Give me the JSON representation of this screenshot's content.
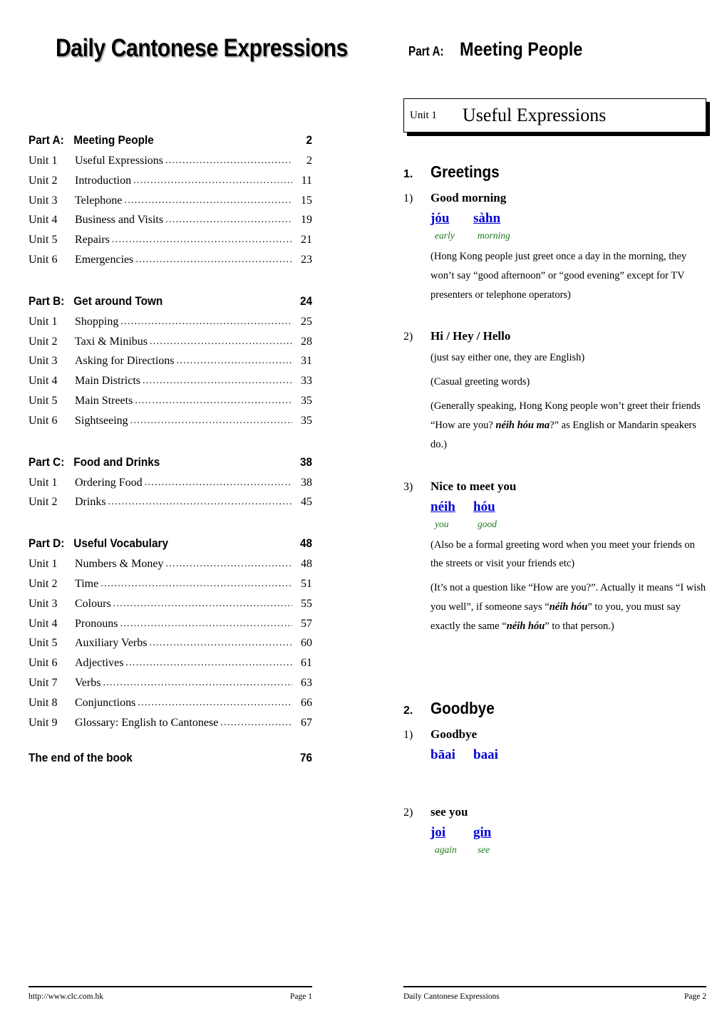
{
  "document": {
    "title": "Daily Cantonese Expressions"
  },
  "right_header": {
    "part_label": "Part A:",
    "part_title": "Meeting People"
  },
  "toc": {
    "parts": [
      {
        "label": "Part A:",
        "title": "Meeting People",
        "page": "2",
        "units": [
          {
            "label": "Unit 1",
            "title": "Useful Expressions",
            "page": "2"
          },
          {
            "label": "Unit 2",
            "title": "Introduction",
            "page": "11"
          },
          {
            "label": "Unit 3",
            "title": "Telephone",
            "page": "15"
          },
          {
            "label": "Unit 4",
            "title": "Business and Visits",
            "page": "19"
          },
          {
            "label": "Unit 5",
            "title": "Repairs",
            "page": "21"
          },
          {
            "label": "Unit 6",
            "title": "Emergencies",
            "page": "23"
          }
        ]
      },
      {
        "label": "Part B:",
        "title": "Get around Town",
        "page": "24",
        "units": [
          {
            "label": "Unit 1",
            "title": "Shopping",
            "page": "25"
          },
          {
            "label": "Unit 2",
            "title": "Taxi & Minibus",
            "page": "28"
          },
          {
            "label": "Unit 3",
            "title": "Asking for Directions",
            "page": "31"
          },
          {
            "label": "Unit 4",
            "title": "Main Districts",
            "page": "33"
          },
          {
            "label": "Unit 5",
            "title": "Main Streets",
            "page": "35"
          },
          {
            "label": "Unit 6",
            "title": "Sightseeing",
            "page": "35"
          }
        ]
      },
      {
        "label": "Part C:",
        "title": "Food and Drinks",
        "page": "38",
        "units": [
          {
            "label": "Unit 1",
            "title": "Ordering Food",
            "page": "38"
          },
          {
            "label": "Unit 2",
            "title": "Drinks",
            "page": "45"
          }
        ]
      },
      {
        "label": "Part D:",
        "title": "Useful Vocabulary",
        "page": "48",
        "units": [
          {
            "label": "Unit 1",
            "title": "Numbers & Money",
            "page": "48"
          },
          {
            "label": "Unit 2",
            "title": "Time",
            "page": "51"
          },
          {
            "label": "Unit 3",
            "title": "Colours",
            "page": "55"
          },
          {
            "label": "Unit 4",
            "title": "Pronouns",
            "page": "57"
          },
          {
            "label": "Unit 5",
            "title": "Auxiliary Verbs",
            "page": "60"
          },
          {
            "label": "Unit 6",
            "title": "Adjectives",
            "page": "61"
          },
          {
            "label": "Unit 7",
            "title": "Verbs",
            "page": "63"
          },
          {
            "label": "Unit 8",
            "title": "Conjunctions",
            "page": "66"
          },
          {
            "label": "Unit 9",
            "title": "Glossary: English to Cantonese",
            "page": "67"
          }
        ]
      }
    ],
    "end": {
      "title": "The end of the book",
      "page": "76"
    }
  },
  "lesson": {
    "unit_box": {
      "unit": "Unit 1",
      "title": "Useful Expressions"
    },
    "sections": [
      {
        "number": "1.",
        "title": "Greetings",
        "items": [
          {
            "number": "1)",
            "head": "Good morning",
            "romanization": [
              "jóu",
              "sàhn"
            ],
            "glosses": [
              "early",
              "morning"
            ],
            "notes": [
              "(Hong Kong people just greet once a day in the morning, they won’t say “good afternoon” or “good evening” except for TV presenters or telephone operators)"
            ]
          },
          {
            "number": "2)",
            "head": "Hi / Hey / Hello",
            "romanization": [],
            "glosses": [],
            "notes": [
              "(just say either one, they are English)",
              "(Casual greeting words)",
              "(Generally speaking, Hong Kong people won’t greet their friends “How are you? néih hóu ma?” as English or Mandarin speakers do.)"
            ]
          },
          {
            "number": "3)",
            "head": "Nice to meet you",
            "romanization": [
              "néih",
              "hóu"
            ],
            "glosses": [
              "you",
              "good"
            ],
            "notes": [
              "(Also be a formal greeting word when you meet your friends on the streets or visit your friends etc)",
              "(It’s not a question like “How are you?”. Actually it means “I wish you well”, if someone says “néih hóu” to you, you must say exactly the same “néih hóu” to that person.)"
            ]
          }
        ]
      },
      {
        "number": "2.",
        "title": "Goodbye",
        "items": [
          {
            "number": "1)",
            "head": "Goodbye",
            "romanization": [
              "bāai",
              "baai"
            ],
            "glosses": [],
            "notes": []
          },
          {
            "number": "2)",
            "head": "see you",
            "romanization": [
              "joi",
              "gin"
            ],
            "glosses": [
              "again",
              "see"
            ],
            "notes": []
          }
        ]
      }
    ],
    "note_fragments": {
      "note_2c_pre": "(Generally speaking, Hong Kong people won’t greet their friends “How are you? ",
      "note_2c_bi": "néih hóu ma",
      "note_2c_post": "?” as English or Mandarin speakers do.)",
      "note_3b_pre": "(It’s not a question like “How are you?”. Actually it means “I wish you well”, if someone says “",
      "note_3b_bi1": "néih hóu",
      "note_3b_mid": "” to you, you must say exactly the same “",
      "note_3b_bi2": "néih hóu",
      "note_3b_post": "” to that person.)"
    }
  },
  "footers": {
    "left": {
      "left_text": "http://www.clc.com.hk",
      "right_text": "Page 1"
    },
    "right": {
      "left_text": "Daily Cantonese Expressions",
      "right_text": "Page 2"
    }
  },
  "colors": {
    "romanization": "#0000d8",
    "gloss": "#1f7a1f",
    "text": "#000000"
  }
}
